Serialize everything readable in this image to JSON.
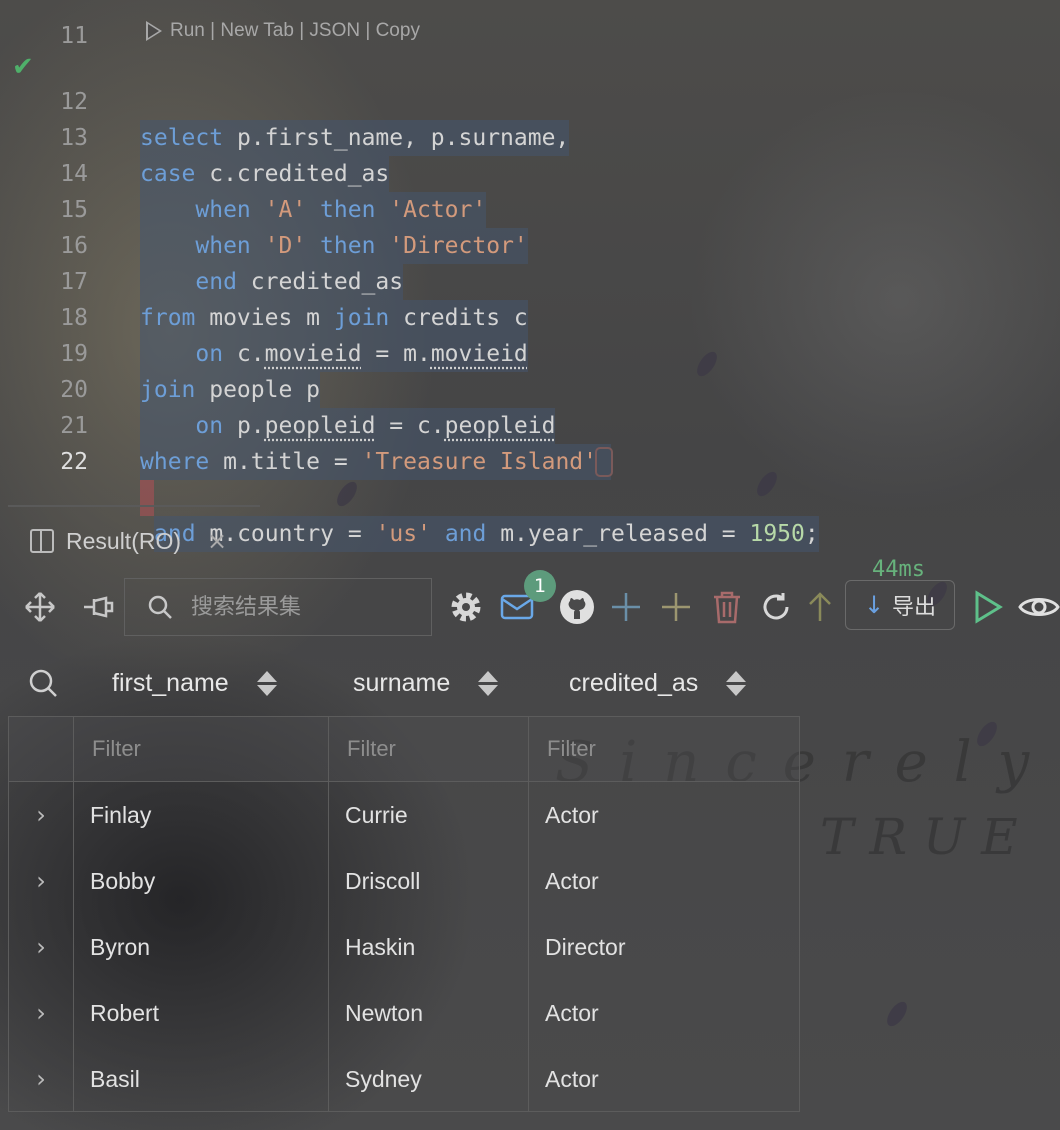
{
  "editor": {
    "codelens": "Run | New Tab | JSON | Copy",
    "partial_line_number": "11",
    "timing": "44ms",
    "lines": [
      {
        "n": "12"
      },
      {
        "n": "13"
      },
      {
        "n": "14"
      },
      {
        "n": "15"
      },
      {
        "n": "16"
      },
      {
        "n": "17"
      },
      {
        "n": "18"
      },
      {
        "n": "19"
      },
      {
        "n": "20"
      },
      {
        "n": "21"
      },
      {
        "n": "22"
      }
    ]
  },
  "background": {
    "watermark_line1": "Sincerely",
    "watermark_line2": "TRUE"
  },
  "result_tab": {
    "label": "Result(RO)",
    "close": "×"
  },
  "toolbar": {
    "search_placeholder": "搜索结果集",
    "mail_badge": "1",
    "export_label": "导出"
  },
  "table": {
    "columns": [
      "first_name",
      "surname",
      "credited_as"
    ],
    "filter_placeholder": "Filter",
    "rows": [
      [
        "Finlay",
        "Currie",
        "Actor"
      ],
      [
        "Bobby",
        "Driscoll",
        "Actor"
      ],
      [
        "Byron",
        "Haskin",
        "Director"
      ],
      [
        "Robert",
        "Newton",
        "Actor"
      ],
      [
        "Basil",
        "Sydney",
        "Actor"
      ]
    ]
  }
}
